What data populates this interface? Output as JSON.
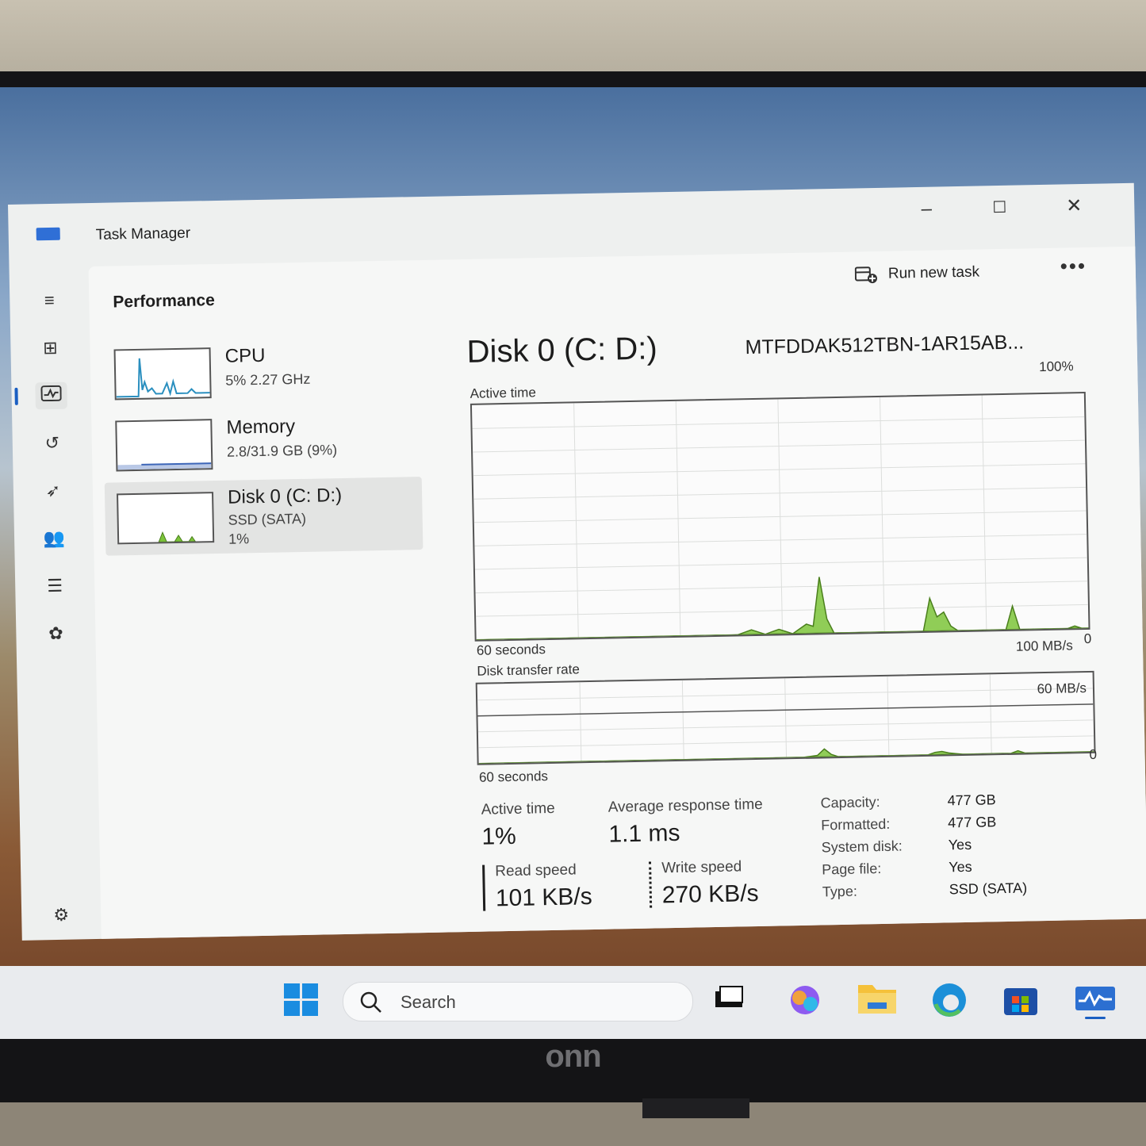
{
  "app": {
    "title": "Task Manager"
  },
  "window_controls": {
    "minimize": "–",
    "maximize": "☐",
    "close": "✕"
  },
  "header": {
    "section_title": "Performance",
    "run_task_label": "Run new task",
    "more_label": "•••"
  },
  "devices": [
    {
      "name": "CPU",
      "line1": "5% 2.27 GHz",
      "line2": ""
    },
    {
      "name": "Memory",
      "line1": "2.8/31.9 GB (9%)",
      "line2": ""
    },
    {
      "name": "Disk 0 (C: D:)",
      "line1": "SSD (SATA)",
      "line2": "1%"
    }
  ],
  "detail": {
    "title": "Disk 0 (C: D:)",
    "model": "MTFDDAK512TBN-1AR15AB...",
    "active_time_chart": {
      "label": "Active time",
      "max_label": "100%",
      "min_label": "0",
      "time_label": "60 seconds"
    },
    "transfer_chart": {
      "label": "Disk transfer rate",
      "max_label": "100 MB/s",
      "mid_label": "60 MB/s",
      "min_label": "0",
      "time_label": "60 seconds"
    },
    "stats": {
      "active_time_label": "Active time",
      "active_time_value": "1%",
      "avg_response_label": "Average response time",
      "avg_response_value": "1.1 ms",
      "read_label": "Read speed",
      "read_value": "101 KB/s",
      "write_label": "Write speed",
      "write_value": "270 KB/s"
    },
    "properties": [
      {
        "key": "Capacity:",
        "value": "477 GB"
      },
      {
        "key": "Formatted:",
        "value": "477 GB"
      },
      {
        "key": "System disk:",
        "value": "Yes"
      },
      {
        "key": "Page file:",
        "value": "Yes"
      },
      {
        "key": "Type:",
        "value": "SSD (SATA)"
      }
    ]
  },
  "active_time_series": [
    0,
    0,
    0,
    0,
    0,
    0,
    0,
    0,
    0,
    0,
    0,
    0,
    0,
    0,
    0,
    0,
    0,
    0,
    0,
    0,
    0,
    0,
    0,
    0,
    0,
    0,
    0,
    0,
    0,
    0,
    0,
    0,
    0,
    0,
    0,
    0,
    0,
    0,
    0,
    1,
    2,
    1,
    0,
    1,
    2,
    1,
    0,
    2,
    4,
    3,
    24,
    6,
    0,
    0,
    0,
    0,
    0,
    0,
    0,
    0,
    0,
    0,
    0,
    0,
    0,
    0,
    14,
    6,
    8,
    2,
    0,
    0,
    0,
    0,
    0,
    0,
    0,
    0,
    10,
    0,
    0,
    0,
    0,
    0,
    0,
    0,
    0,
    1,
    0,
    0
  ],
  "transfer_series": [
    0,
    0,
    0,
    0,
    0,
    0,
    0,
    0,
    0,
    0,
    0,
    0,
    0,
    0,
    0,
    0,
    0,
    0,
    0,
    0,
    0,
    0,
    0,
    0,
    0,
    0,
    0,
    0,
    0,
    0,
    0,
    0,
    0,
    0,
    0,
    0,
    0,
    0,
    0,
    0,
    0,
    0,
    0,
    0,
    0,
    0,
    0,
    0,
    1,
    2,
    10,
    3,
    0,
    0,
    0,
    0,
    0,
    0,
    0,
    0,
    0,
    0,
    0,
    0,
    0,
    0,
    3,
    4,
    2,
    1,
    0,
    0,
    0,
    0,
    0,
    0,
    0,
    0,
    3,
    0,
    0,
    0,
    0,
    0,
    0,
    0,
    0,
    0,
    0,
    0
  ],
  "taskbar": {
    "search_placeholder": "Search"
  },
  "monitor_brand": "onn",
  "colors": {
    "accent": "#1b5fc2",
    "disk_green": "#7cc43a"
  }
}
